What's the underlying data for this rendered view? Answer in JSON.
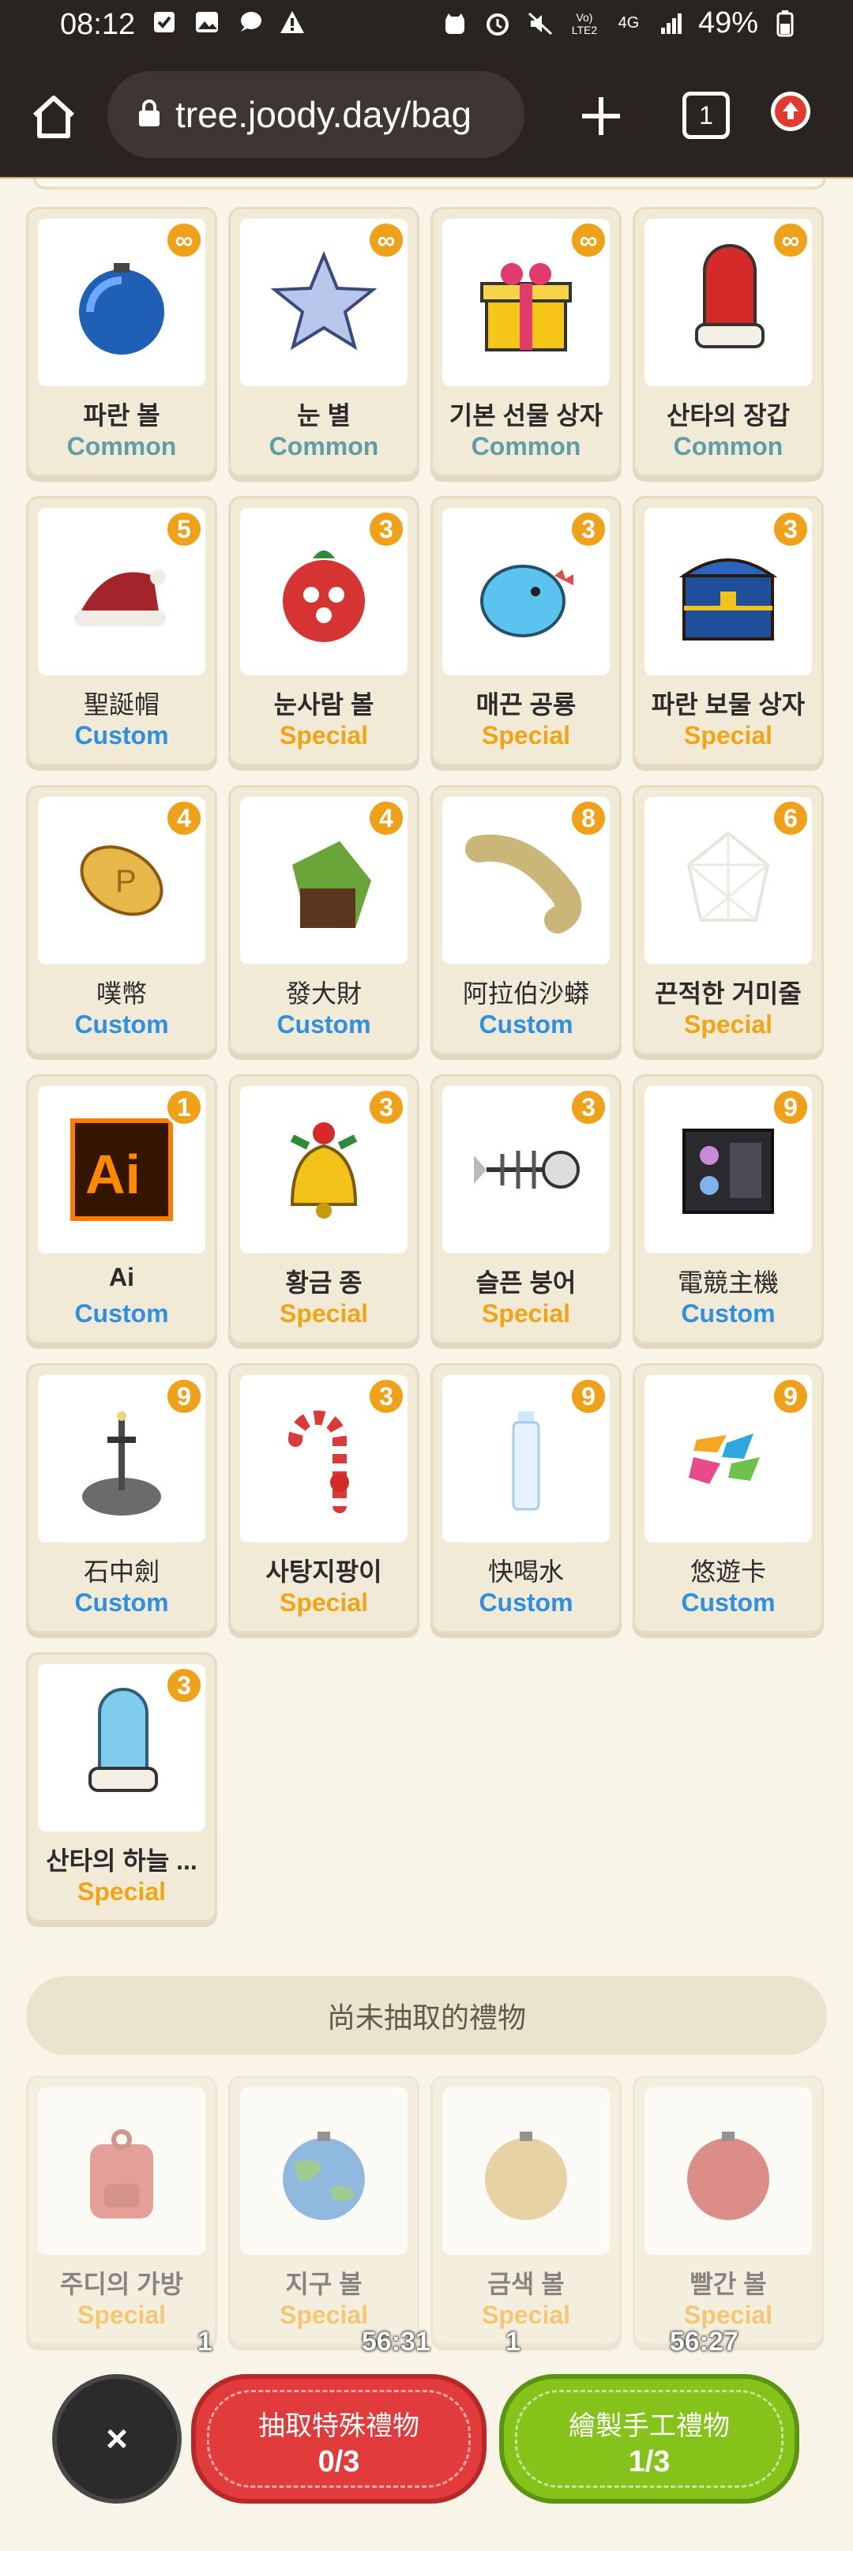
{
  "statusbar": {
    "time": "08:12",
    "battery": "49%",
    "network": "4G",
    "carrier": "Vo) LTE2"
  },
  "browser": {
    "url": "tree.joody.day/bag",
    "tab_count": "1"
  },
  "items": [
    {
      "name": "파란 볼",
      "rarity": "Common",
      "count": "∞",
      "icon": "blue-ornament",
      "bold": true
    },
    {
      "name": "눈 별",
      "rarity": "Common",
      "count": "∞",
      "icon": "star",
      "bold": true
    },
    {
      "name": "기본 선물 상자",
      "rarity": "Common",
      "count": "∞",
      "icon": "gift-box",
      "bold": true
    },
    {
      "name": "산타의 장갑",
      "rarity": "Common",
      "count": "∞",
      "icon": "red-mitten",
      "bold": true
    },
    {
      "name": "聖誕帽",
      "rarity": "Custom",
      "count": "5",
      "icon": "santa-hat",
      "bold": false
    },
    {
      "name": "눈사람 볼",
      "rarity": "Special",
      "count": "3",
      "icon": "red-ornament",
      "bold": true
    },
    {
      "name": "매끈 공룡",
      "rarity": "Special",
      "count": "3",
      "icon": "blue-dinosaur",
      "bold": true
    },
    {
      "name": "파란 보물 상자",
      "rarity": "Special",
      "count": "3",
      "icon": "treasure-chest",
      "bold": true
    },
    {
      "name": "噗幣",
      "rarity": "Custom",
      "count": "4",
      "icon": "gold-coin",
      "bold": false
    },
    {
      "name": "發大財",
      "rarity": "Custom",
      "count": "4",
      "icon": "money-bag",
      "bold": false
    },
    {
      "name": "阿拉伯沙蟒",
      "rarity": "Custom",
      "count": "8",
      "icon": "sand-snake",
      "bold": false
    },
    {
      "name": "끈적한 거미줄",
      "rarity": "Special",
      "count": "6",
      "icon": "spider-web",
      "bold": true
    },
    {
      "name": "Ai",
      "rarity": "Custom",
      "count": "1",
      "icon": "ai-logo",
      "bold": true
    },
    {
      "name": "황금 종",
      "rarity": "Special",
      "count": "3",
      "icon": "golden-bell",
      "bold": true
    },
    {
      "name": "슬픈 붕어",
      "rarity": "Special",
      "count": "3",
      "icon": "fish-bone",
      "bold": true
    },
    {
      "name": "電競主機",
      "rarity": "Custom",
      "count": "9",
      "icon": "gaming-pc",
      "bold": false
    },
    {
      "name": "石中劍",
      "rarity": "Custom",
      "count": "9",
      "icon": "sword-in-stone",
      "bold": false
    },
    {
      "name": "사탕지팡이",
      "rarity": "Special",
      "count": "3",
      "icon": "candy-cane",
      "bold": true
    },
    {
      "name": "快喝水",
      "rarity": "Custom",
      "count": "9",
      "icon": "water-bottle",
      "bold": false
    },
    {
      "name": "悠遊卡",
      "rarity": "Custom",
      "count": "9",
      "icon": "easycard",
      "bold": false
    },
    {
      "name": "산타의 하늘 ...",
      "rarity": "Special",
      "count": "3",
      "icon": "blue-mitten",
      "bold": true
    }
  ],
  "undrawn_section": {
    "title": "尚未抽取的禮物"
  },
  "undrawn_items": [
    {
      "name": "주디의 가방",
      "rarity": "Special",
      "icon": "backpack"
    },
    {
      "name": "지구 볼",
      "rarity": "Special",
      "icon": "earth-ornament"
    },
    {
      "name": "금색 볼",
      "rarity": "Special",
      "icon": "gold-ornament"
    },
    {
      "name": "빨간 볼",
      "rarity": "Special",
      "icon": "red-ball-ornament"
    }
  ],
  "timers": [
    {
      "number": "1",
      "time": "56:31"
    },
    {
      "number": "1",
      "time": "56:27"
    }
  ],
  "actions": {
    "close_label": "×",
    "special": {
      "label": "抽取特殊禮物",
      "count": "0/3"
    },
    "handmade": {
      "label": "繪製手工禮物",
      "count": "1/3"
    }
  },
  "colors": {
    "common": "#5f9ea6",
    "custom": "#2f8fe0",
    "special": "#f2a514",
    "badge": "#f0a11a",
    "special_btn": "#e13b3b",
    "handmade_btn": "#85c21a"
  }
}
